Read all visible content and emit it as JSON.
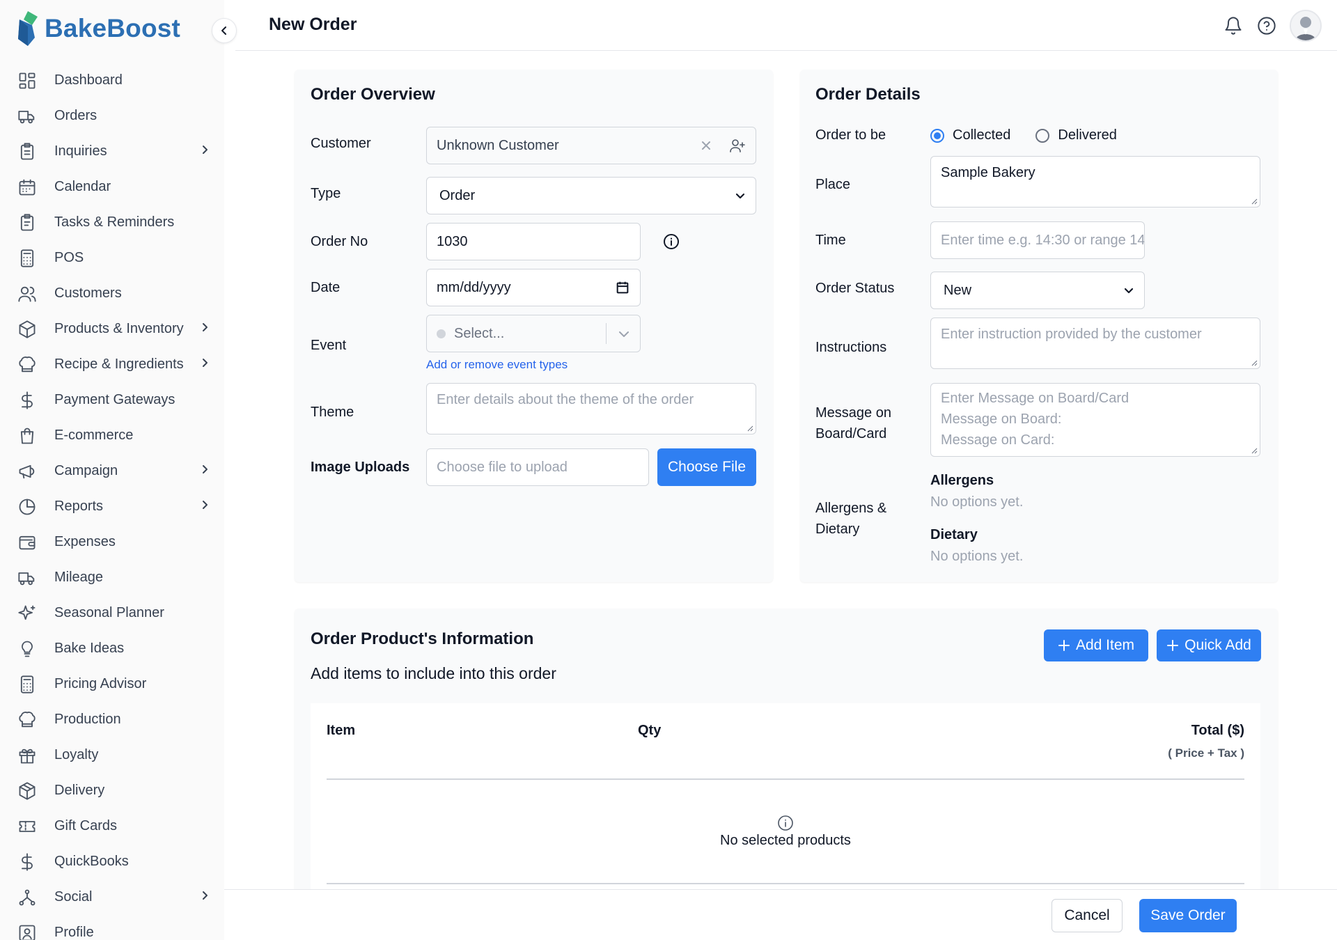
{
  "brand": {
    "name": "BakeBoost",
    "primary": "#2f7ff2",
    "logo_blue": "#2c6fb3",
    "logo_green": "#3fb77a"
  },
  "sidebar": {
    "items": [
      {
        "label": "Dashboard",
        "icon": "dashboard-icon",
        "has_submenu": false
      },
      {
        "label": "Orders",
        "icon": "truck-icon",
        "has_submenu": false
      },
      {
        "label": "Inquiries",
        "icon": "clipboard-icon",
        "has_submenu": true
      },
      {
        "label": "Calendar",
        "icon": "calendar-icon",
        "has_submenu": false
      },
      {
        "label": "Tasks & Reminders",
        "icon": "clipboard-list-icon",
        "has_submenu": false
      },
      {
        "label": "POS",
        "icon": "calculator-icon",
        "has_submenu": false
      },
      {
        "label": "Customers",
        "icon": "users-icon",
        "has_submenu": false
      },
      {
        "label": "Products & Inventory",
        "icon": "box-icon",
        "has_submenu": true
      },
      {
        "label": "Recipe & Ingredients",
        "icon": "chef-hat-icon",
        "has_submenu": true
      },
      {
        "label": "Payment Gateways",
        "icon": "dollar-icon",
        "has_submenu": false
      },
      {
        "label": "E-commerce",
        "icon": "shopping-bag-icon",
        "has_submenu": false
      },
      {
        "label": "Campaign",
        "icon": "megaphone-icon",
        "has_submenu": true
      },
      {
        "label": "Reports",
        "icon": "pie-chart-icon",
        "has_submenu": true
      },
      {
        "label": "Expenses",
        "icon": "wallet-icon",
        "has_submenu": false
      },
      {
        "label": "Mileage",
        "icon": "truck-icon",
        "has_submenu": false
      },
      {
        "label": "Seasonal Planner",
        "icon": "sparkles-icon",
        "has_submenu": false
      },
      {
        "label": "Bake Ideas",
        "icon": "lightbulb-icon",
        "has_submenu": false
      },
      {
        "label": "Pricing Advisor",
        "icon": "calculator-icon",
        "has_submenu": false
      },
      {
        "label": "Production",
        "icon": "chef-hat-icon",
        "has_submenu": false
      },
      {
        "label": "Loyalty",
        "icon": "gift-icon",
        "has_submenu": false
      },
      {
        "label": "Delivery",
        "icon": "package-icon",
        "has_submenu": false
      },
      {
        "label": "Gift Cards",
        "icon": "ticket-icon",
        "has_submenu": false
      },
      {
        "label": "QuickBooks",
        "icon": "dollar-icon",
        "has_submenu": false
      },
      {
        "label": "Social",
        "icon": "network-icon",
        "has_submenu": true
      },
      {
        "label": "Profile",
        "icon": "profile-icon",
        "has_submenu": false
      }
    ]
  },
  "header": {
    "title": "New Order"
  },
  "overview": {
    "title": "Order Overview",
    "customer_label": "Customer",
    "customer_value": "Unknown Customer",
    "type_label": "Type",
    "type_value": "Order",
    "order_no_label": "Order No",
    "order_no_value": "1030",
    "date_label": "Date",
    "date_placeholder": "mm/dd/yyyy",
    "event_label": "Event",
    "event_placeholder": "Select...",
    "event_link": "Add or remove event types",
    "theme_label": "Theme",
    "theme_placeholder": "Enter details about the theme of the order",
    "image_label": "Image Uploads",
    "image_placeholder": "Choose file to upload",
    "choose_file": "Choose File"
  },
  "details": {
    "title": "Order Details",
    "order_to_be_label": "Order to be",
    "collected": "Collected",
    "delivered": "Delivered",
    "selected_option": "Collected",
    "place_label": "Place",
    "place_value": "Sample Bakery",
    "time_label": "Time",
    "time_placeholder": "Enter time e.g. 14:30 or range 14",
    "status_label": "Order Status",
    "status_value": "New",
    "instructions_label": "Instructions",
    "instructions_placeholder": "Enter instruction provided by the customer",
    "message_label_1": "Message on",
    "message_label_2": "Board/Card",
    "message_placeholder_1": "Enter Message on Board/Card",
    "message_placeholder_2": "Message on Board:",
    "message_placeholder_3": "Message on Card:",
    "allergens_label_1": "Allergens &",
    "allergens_label_2": "Dietary",
    "allergens_heading": "Allergens",
    "allergens_empty": "No options yet.",
    "dietary_heading": "Dietary",
    "dietary_empty": "No options yet."
  },
  "products": {
    "title": "Order Product's Information",
    "subtitle": "Add items to include into this order",
    "add_item": "Add Item",
    "quick_add": "Quick Add",
    "columns": {
      "item": "Item",
      "qty": "Qty",
      "total": "Total ($)",
      "total_sub": "( Price + Tax )"
    },
    "empty": "No selected products"
  },
  "footer": {
    "cancel": "Cancel",
    "save": "Save Order"
  }
}
